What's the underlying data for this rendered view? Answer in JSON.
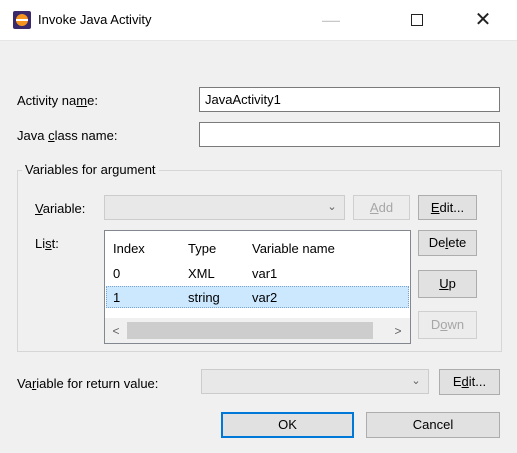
{
  "window": {
    "title": "Invoke Java Activity",
    "minimize_glyph": "—",
    "close_glyph": "✕",
    "icon": "eclipse-app-icon"
  },
  "form": {
    "activity_name_label_pre": "Activity na",
    "activity_name_label_mn": "m",
    "activity_name_label_post": "e:",
    "activity_name_value": "JavaActivity1",
    "java_class_label_pre": "Java ",
    "java_class_label_mn": "c",
    "java_class_label_post": "lass name:",
    "java_class_value": ""
  },
  "variables_group": {
    "title": "Variables for argument",
    "variable_label_mn": "V",
    "variable_label_post": "ariable:",
    "variable_selected": "",
    "add_mn": "A",
    "add_post": "dd",
    "edit_mn": "E",
    "edit_post": "dit...",
    "list_label_pre": "Li",
    "list_label_mn": "s",
    "list_label_post": "t:",
    "delete_pre": "De",
    "delete_mn": "l",
    "delete_post": "ete",
    "up_mn": "U",
    "up_post": "p",
    "down_pre": "D",
    "down_mn": "o",
    "down_post": "wn",
    "columns": [
      "Index",
      "Type",
      "Variable name"
    ],
    "rows": [
      [
        "0",
        "XML",
        "var1"
      ],
      [
        "1",
        "string",
        "var2"
      ]
    ],
    "scroll_left": "<",
    "scroll_right": ">"
  },
  "return_value": {
    "label_pre": "Va",
    "label_mn": "r",
    "label_post": "iable for return value:",
    "selected": "",
    "edit_pre": "E",
    "edit_mn": "d",
    "edit_post": "it..."
  },
  "footer": {
    "ok": "OK",
    "cancel": "Cancel"
  },
  "colors": {
    "selection": "#cce8ff",
    "default_button_border": "#0078d7"
  }
}
